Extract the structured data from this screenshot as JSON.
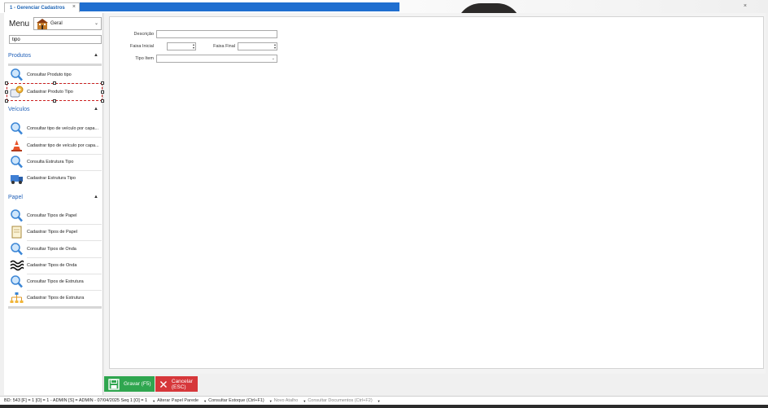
{
  "tab": {
    "title": "1 - Gerenciar Cadastros",
    "close_glyph": "×"
  },
  "window": {
    "close_glyph": "×"
  },
  "sidebar": {
    "menu_title": "Menu",
    "module_select": "Geral",
    "search_value": "tipo",
    "groups": [
      {
        "title": "Produtos",
        "items": [
          {
            "label": "Consultar Produto tipo",
            "icon": "magnifier-icon"
          },
          {
            "label": "Cadastrar Produto Tipo",
            "icon": "gear-tag-icon"
          }
        ]
      },
      {
        "title": "Veículos",
        "items": [
          {
            "label": "Consultar tipo de veículo por capa...",
            "icon": "magnifier-icon"
          },
          {
            "label": "Cadastrar tipo de veículo por capa...",
            "icon": "traffic-cone-icon"
          },
          {
            "label": "Consulta Estrutura Tipo",
            "icon": "magnifier-icon"
          },
          {
            "label": "Cadastrar Estrutura Tipo",
            "icon": "truck-icon"
          }
        ]
      },
      {
        "title": "Papel",
        "items": [
          {
            "label": "Consultar Tipos de Papel",
            "icon": "magnifier-icon"
          },
          {
            "label": "Cadastrar Tipos de Papel",
            "icon": "paper-icon"
          },
          {
            "label": "Consultar Tipos de Onda",
            "icon": "magnifier-icon"
          },
          {
            "label": "Cadastrar Tipos de Onda",
            "icon": "wave-icon"
          },
          {
            "label": "Consultar Tipos de Estrutura",
            "icon": "magnifier-icon"
          },
          {
            "label": "Cadastrar Tipos de Estrutura",
            "icon": "hierarchy-icon"
          }
        ]
      }
    ]
  },
  "form": {
    "descricao_label": "Descrição",
    "faixa_inicial_label": "Faixa Inicial",
    "faixa_final_label": "Faixa Final",
    "tipo_item_label": "Tipo Item"
  },
  "footer": {
    "save_label": "Gravar (F5)",
    "cancel_label": "Cancelar (ESC)"
  },
  "status": {
    "main": "BD: 543   [F] = 1  [O] = 1 - ADMIN [S] = ADMIN  -  07/04/2025 Seq 1  [O] = 1",
    "links": [
      "Alterar Papel Parede",
      "Consultar Estoque (Ctrl+F1)",
      "Novo Atalho",
      "Consultar Documentos (Ctrl+F2)"
    ]
  },
  "colors": {
    "accent": "#2261b8",
    "tab_bar": "#1f6fd0",
    "save": "#2fa64f",
    "cancel": "#d6373a"
  }
}
